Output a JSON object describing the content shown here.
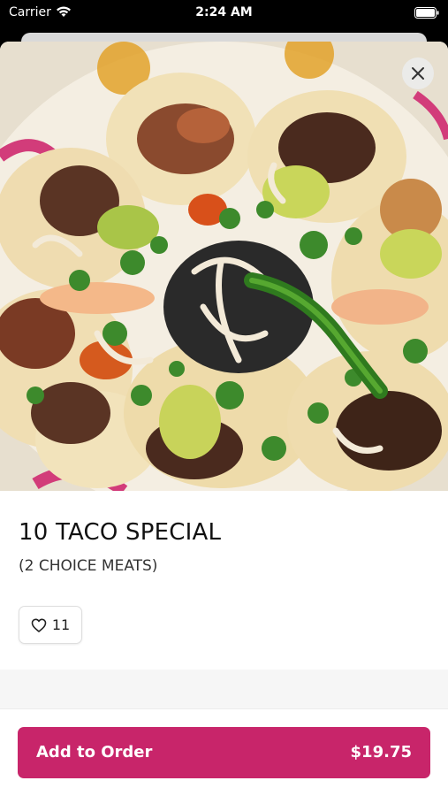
{
  "status_bar": {
    "carrier": "Carrier",
    "time": "2:24 AM",
    "icons": [
      "wifi-icon",
      "battery-icon"
    ]
  },
  "hero": {
    "image": "photo of tacos with meats, cilantro, onions, salsa verde and grilled pepper",
    "close_icon": "close-icon"
  },
  "item": {
    "title": "10 TACO SPECIAL",
    "subtitle": "(2 CHOICE MEATS)"
  },
  "like": {
    "icon": "heart-icon",
    "count": "11"
  },
  "order": {
    "label": "Add to Order",
    "price": "$19.75"
  },
  "colors": {
    "accent": "#c8256a",
    "background": "#ffffff",
    "band": "#f6f6f6"
  }
}
